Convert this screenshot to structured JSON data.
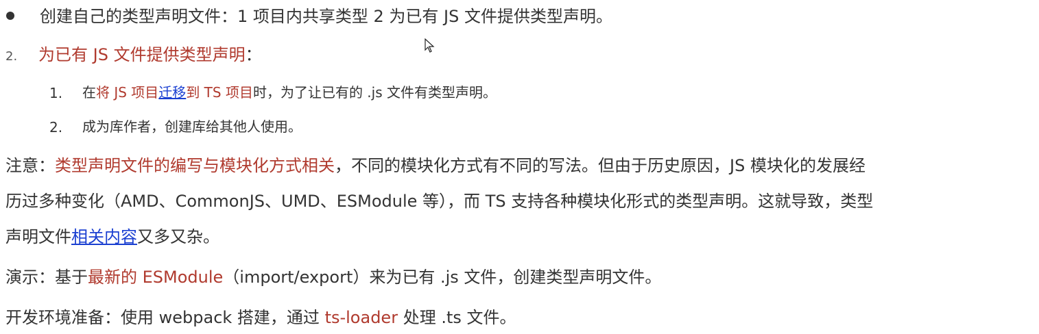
{
  "bullet": {
    "text": "创建自己的类型声明文件：1 项目内共享类型 2 为已有 JS 文件提供类型声明。"
  },
  "section": {
    "number": "2.",
    "title_highlight": "为已有 JS 文件提供类型声明",
    "title_suffix": "："
  },
  "subitems": [
    {
      "number": "1.",
      "pre": "在",
      "red_a": "将 JS 项目",
      "link": "迁移",
      "red_b": "到 TS 项目",
      "post": "时，为了让已有的 .js 文件有类型声明。"
    },
    {
      "number": "2.",
      "text": "成为库作者，创建库给其他人使用。"
    }
  ],
  "note": {
    "label": "注意：",
    "highlight": "类型声明文件的编写与模块化方式相关",
    "line1_rest": "，不同的模块化方式有不同的写法。但由于历史原因，JS 模块化的发展经",
    "line2": "历过多种变化（AMD、CommonJS、UMD、ESModule 等），而 TS 支持各种模块化形式的类型声明。这就导致，类型",
    "line3_pre": "声明文件",
    "line3_link": "相关内容",
    "line3_post": "又多又杂。"
  },
  "demo": {
    "label": "演示：基于",
    "highlight": "最新的 ESModule",
    "rest": "（import/export）来为已有 .js 文件，创建类型声明文件。"
  },
  "env": {
    "label": "开发环境准备：使用 webpack 搭建，通过 ",
    "highlight": "ts-loader",
    "rest": " 处理 .ts 文件。"
  },
  "colors": {
    "highlight": "#b03a2e",
    "link": "#1a3fd1",
    "text": "#333333"
  },
  "icons": {
    "bullet": "bullet-dot-icon",
    "cursor": "mouse-pointer-icon"
  }
}
